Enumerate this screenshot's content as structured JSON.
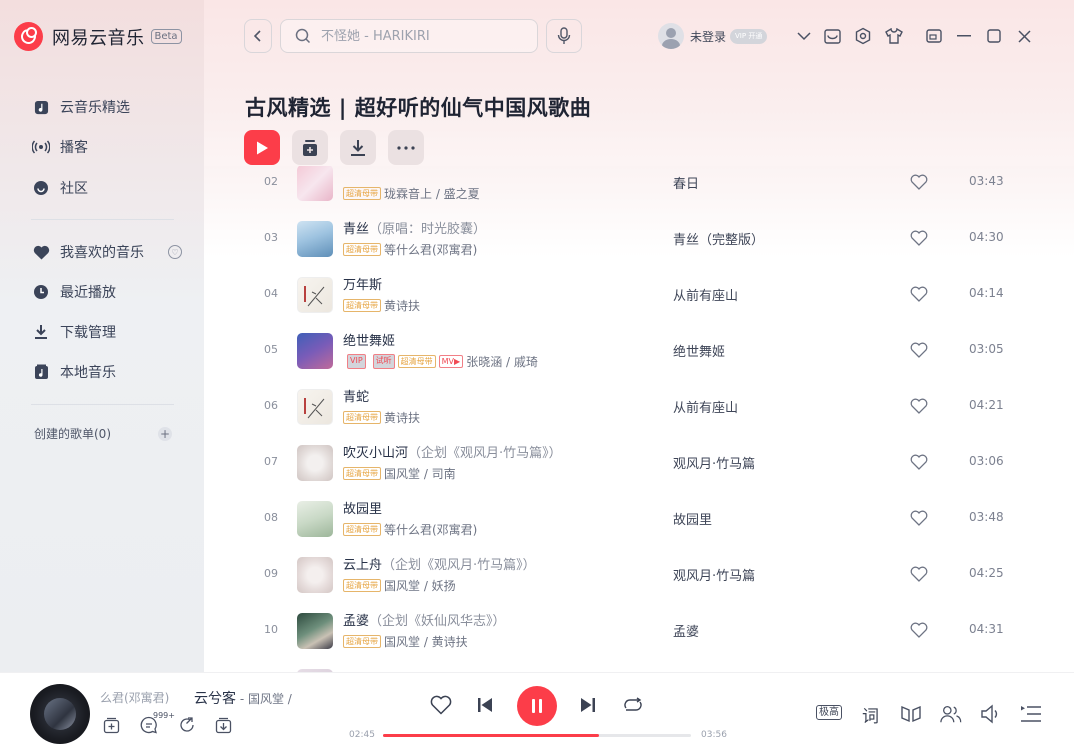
{
  "app": {
    "name": "网易云音乐",
    "beta": "Beta"
  },
  "sidebar": {
    "top_items": [
      {
        "label": "云音乐精选",
        "icon": "music-note-icon"
      },
      {
        "label": "播客",
        "icon": "podcast-icon"
      },
      {
        "label": "社区",
        "icon": "community-icon"
      }
    ],
    "my_items": [
      {
        "label": "我喜欢的音乐",
        "icon": "heart-icon"
      },
      {
        "label": "最近播放",
        "icon": "clock-icon"
      },
      {
        "label": "下载管理",
        "icon": "download-icon"
      },
      {
        "label": "本地音乐",
        "icon": "local-music-icon"
      }
    ],
    "created_playlists": "创建的歌单(0)"
  },
  "header": {
    "search_placeholder": "不怪她 - HARIKIRI",
    "user_label": "未登录",
    "vip_label": "VIP 开通"
  },
  "playlist": {
    "title": "古风精选 | 超好听的仙气中国风歌曲"
  },
  "songs": [
    {
      "num": "02",
      "title": "",
      "sub": "",
      "tags": [
        "超清母带"
      ],
      "artists": "珑霖音上 / 盛之夏",
      "album": "春日",
      "duration": "03:43"
    },
    {
      "num": "03",
      "title": "青丝",
      "sub": "（原唱：时光胶囊）",
      "tags": [
        "超清母带"
      ],
      "artists": "等什么君(邓寓君)",
      "album": "青丝（完整版）",
      "duration": "04:30"
    },
    {
      "num": "04",
      "title": "万年斯",
      "sub": "",
      "tags": [
        "超清母带"
      ],
      "artists": "黄诗扶",
      "album": "从前有座山",
      "duration": "04:14"
    },
    {
      "num": "05",
      "title": "绝世舞姬",
      "sub": "",
      "tags": [
        "VIP",
        "试听",
        "超清母带",
        "MV▶"
      ],
      "artists": "张晓涵 / 戚琦",
      "album": "绝世舞姬",
      "duration": "03:05"
    },
    {
      "num": "06",
      "title": "青蛇",
      "sub": "",
      "tags": [
        "超清母带"
      ],
      "artists": "黄诗扶",
      "album": "从前有座山",
      "duration": "04:21"
    },
    {
      "num": "07",
      "title": "吹灭小山河",
      "sub": "（企划《观风月·竹马篇》）",
      "tags": [
        "超清母带"
      ],
      "artists": "国风堂 / 司南",
      "album": "观风月·竹马篇",
      "duration": "03:06"
    },
    {
      "num": "08",
      "title": "故园里",
      "sub": "",
      "tags": [
        "超清母带"
      ],
      "artists": "等什么君(邓寓君)",
      "album": "故园里",
      "duration": "03:48"
    },
    {
      "num": "09",
      "title": "云上舟",
      "sub": "（企划《观风月·竹马篇》）",
      "tags": [
        "超清母带"
      ],
      "artists": "国风堂 / 妖扬",
      "album": "观风月·竹马篇",
      "duration": "04:25"
    },
    {
      "num": "10",
      "title": "孟婆",
      "sub": "（企划《妖仙风华志》）",
      "tags": [
        "超清母带"
      ],
      "artists": "国风堂 / 黄诗扶",
      "album": "孟婆",
      "duration": "04:31"
    }
  ],
  "player": {
    "prev_artist": "么君(邓寓君)",
    "title": "云兮客",
    "artist": " - 国风堂 /",
    "comment_count": "999+",
    "current_time": "02:45",
    "total_time": "03:56",
    "progress_fraction": 0.7,
    "quality": "极高",
    "lyric": "词"
  },
  "colors": {
    "accent": "#fc3d49",
    "hq_tag": "#e6a33f"
  }
}
